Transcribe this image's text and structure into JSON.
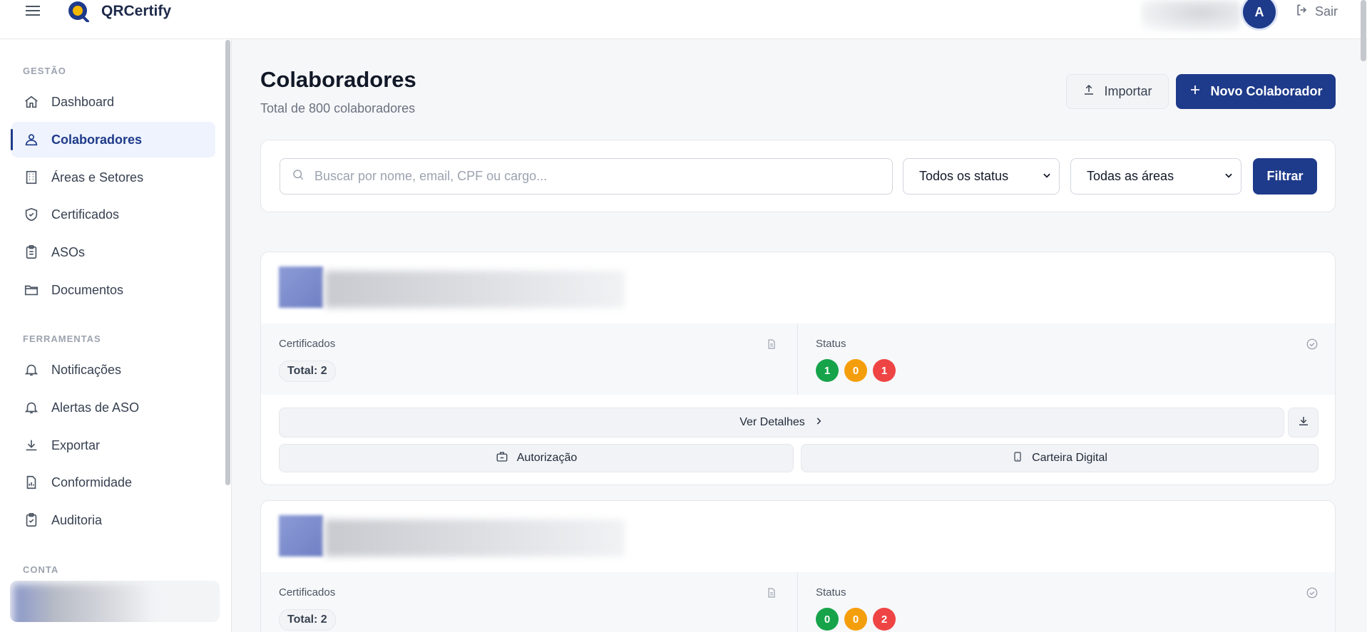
{
  "app": {
    "title": "QRCertify"
  },
  "header": {
    "avatar_letter": "A",
    "logout_label": "Sair"
  },
  "sidebar": {
    "sections": [
      {
        "title": "GESTÃO"
      },
      {
        "title": "FERRAMENTAS"
      },
      {
        "title": "CONTA"
      }
    ],
    "items": [
      {
        "label": "Dashboard",
        "icon": "home-icon",
        "active": false
      },
      {
        "label": "Colaboradores",
        "icon": "users-icon",
        "active": true
      },
      {
        "label": "Áreas e Setores",
        "icon": "building-icon",
        "active": false
      },
      {
        "label": "Certificados",
        "icon": "shield-icon",
        "active": false
      },
      {
        "label": "ASOs",
        "icon": "clipboard-icon",
        "active": false
      },
      {
        "label": "Documentos",
        "icon": "folder-icon",
        "active": false
      },
      {
        "label": "Notificações",
        "icon": "bell-icon",
        "active": false
      },
      {
        "label": "Alertas de ASO",
        "icon": "bell-icon",
        "active": false
      },
      {
        "label": "Exportar",
        "icon": "download-icon",
        "active": false
      },
      {
        "label": "Conformidade",
        "icon": "file-chart-icon",
        "active": false
      },
      {
        "label": "Auditoria",
        "icon": "clipboard-check-icon",
        "active": false
      }
    ]
  },
  "main": {
    "title": "Colaboradores",
    "subtitle": "Total de 800 colaboradores",
    "import_label": "Importar",
    "new_label": "Novo Colaborador",
    "search": {
      "placeholder": "Buscar por nome, email, CPF ou cargo..."
    },
    "status_filter": {
      "selected": "Todos os status"
    },
    "area_filter": {
      "selected": "Todas as áreas"
    },
    "filter_label": "Filtrar"
  },
  "employees": [
    {
      "cert_label": "Certificados",
      "cert_total": "Total: 2",
      "status_label": "Status",
      "status_counts": [
        "1",
        "0",
        "1"
      ],
      "details_label": "Ver Detalhes",
      "auth_label": "Autorização",
      "wallet_label": "Carteira Digital"
    },
    {
      "cert_label": "Certificados",
      "cert_total": "Total: 2",
      "status_label": "Status",
      "status_counts": [
        "0",
        "0",
        "2"
      ]
    }
  ],
  "colors": {
    "primary": "#1e3a8a",
    "green": "#16a34a",
    "orange": "#f59e0b",
    "red": "#ef4444"
  }
}
